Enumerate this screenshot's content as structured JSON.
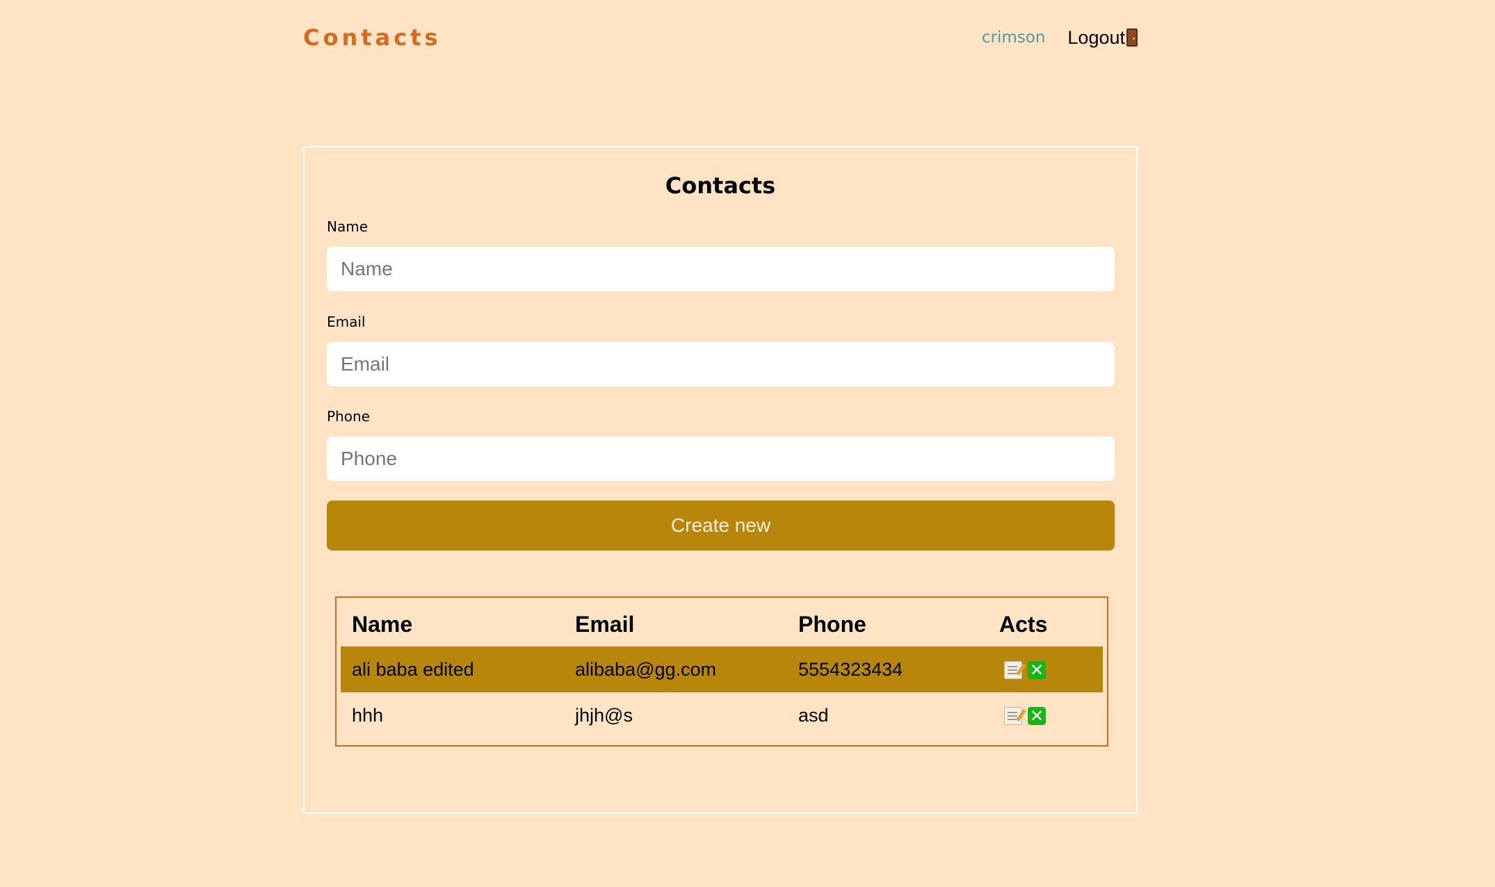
{
  "header": {
    "brand": "Contacts",
    "username": "crimson",
    "logout_label": "Logout"
  },
  "card": {
    "title": "Contacts"
  },
  "form": {
    "name_label": "Name",
    "name_placeholder": "Name",
    "name_value": "",
    "email_label": "Email",
    "email_placeholder": "Email",
    "email_value": "",
    "phone_label": "Phone",
    "phone_placeholder": "Phone",
    "phone_value": "",
    "create_label": "Create new"
  },
  "table": {
    "headers": [
      "Name",
      "Email",
      "Phone",
      "Acts"
    ],
    "rows": [
      {
        "name": "ali baba edited",
        "email": "alibaba@gg.com",
        "phone": "5554323434",
        "highlighted": true
      },
      {
        "name": "hhh",
        "email": "jhjh@s",
        "phone": "asd",
        "highlighted": false
      }
    ],
    "delete_glyph": "✕"
  },
  "icons": {
    "logout": "door-icon",
    "edit": "memo-icon",
    "delete": "cross-mark-icon"
  },
  "colors": {
    "background": "#fee4c4",
    "brand": "#d5691f",
    "username": "#4f9a9f",
    "accent": "#b8860b",
    "table_border": "#d5691f"
  }
}
